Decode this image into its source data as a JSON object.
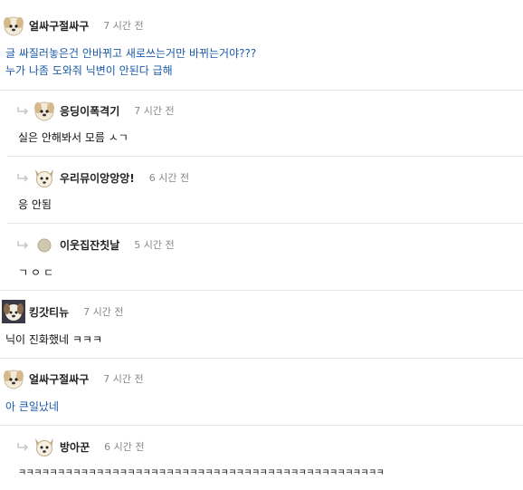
{
  "comments": [
    {
      "nick": "얼싸구절싸구",
      "time": "7 시간 전",
      "body": [
        "글 싸질러놓은건 안바뀌고 새로쓰는거만 바뀌는거야???",
        "누가 나좀 도와줘 닉변이 안된다 급해"
      ],
      "avatar_icon": "puppy-icon"
    },
    {
      "nick": "응딩이폭격기",
      "time": "7 시간 전",
      "body": [
        "실은 안해봐서 모름 ㅅㄱ"
      ],
      "avatar_icon": "puppy-icon"
    },
    {
      "nick": "우리뮤이앙앙앙!",
      "time": "6 시간 전",
      "body": [
        "응 안됨"
      ],
      "avatar_icon": "chihuahua-icon"
    },
    {
      "nick": "이웃집잔칫날",
      "time": "5 시간 전",
      "body": [
        "ㄱㅇㄷ"
      ],
      "avatar_icon": "circle-icon"
    },
    {
      "nick": "킹갓티뉴",
      "time": "7 시간 전",
      "body": [
        "닉이 진화했네 ㅋㅋㅋ"
      ],
      "avatar_icon": "puppy-icon"
    },
    {
      "nick": "얼싸구절싸구",
      "time": "7 시간 전",
      "body": [
        "아 큰일났네"
      ],
      "avatar_icon": "puppy-icon"
    },
    {
      "nick": "방아꾼",
      "time": "6 시간 전",
      "body": [
        "ㅋㅋㅋㅋㅋㅋㅋㅋㅋㅋㅋㅋㅋㅋㅋㅋㅋㅋㅋㅋㅋㅋㅋㅋㅋㅋㅋㅋㅋㅋㅋㅋㅋㅋㅋㅋㅋㅋㅋㅋㅋㅋㅋㅋㅋㅋㅋ"
      ],
      "avatar_icon": "chihuahua-icon"
    }
  ],
  "colors": {
    "link_blue": "#1a5aa8",
    "divider": "#e6e6e6",
    "time_gray": "#888888"
  }
}
